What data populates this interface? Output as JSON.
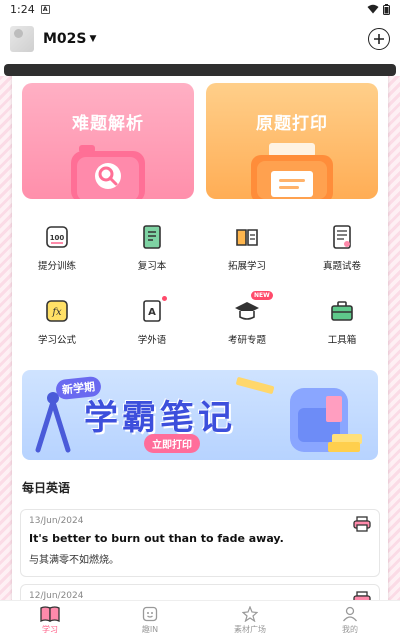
{
  "status_bar": {
    "time": "1:24",
    "notif_badge": "A"
  },
  "header": {
    "device_name": "M02S"
  },
  "cards": [
    {
      "title": "难题解析",
      "color": "#ff93ad"
    },
    {
      "title": "原题打印",
      "color": "#ffad55"
    }
  ],
  "grid": [
    {
      "label": "提分训练",
      "icon": "score-training-icon"
    },
    {
      "label": "复习本",
      "icon": "review-book-icon"
    },
    {
      "label": "拓展学习",
      "icon": "extend-learning-icon"
    },
    {
      "label": "真题试卷",
      "icon": "exam-paper-icon"
    },
    {
      "label": "学习公式",
      "icon": "formula-icon",
      "icon_text": "fx"
    },
    {
      "label": "学外语",
      "icon": "foreign-language-icon",
      "icon_text": "A"
    },
    {
      "label": "考研专题",
      "icon": "graduate-exam-icon",
      "badge": "NEW"
    },
    {
      "label": "工具箱",
      "icon": "toolbox-icon"
    }
  ],
  "banner": {
    "tag": "新学期",
    "headline": "学霸笔记",
    "cta": "立即打印"
  },
  "daily_english": {
    "title": "每日英语",
    "items": [
      {
        "date": "13/Jun/2024",
        "en": "It's better to burn out than to fade away.",
        "cn": "与其满零不如燃烧。"
      },
      {
        "date": "12/Jun/2024"
      }
    ]
  },
  "bottom_nav": [
    {
      "label": "学习",
      "icon": "book-icon",
      "active": true
    },
    {
      "label": "趣IN",
      "icon": "fun-icon",
      "active": false
    },
    {
      "label": "素材广场",
      "icon": "material-icon",
      "active": false
    },
    {
      "label": "我的",
      "icon": "profile-icon",
      "active": false
    }
  ],
  "colors": {
    "accent": "#ff5d86",
    "pink": "#ff93ad",
    "orange": "#ffad55",
    "banner_blue": "#3d4fdc"
  }
}
